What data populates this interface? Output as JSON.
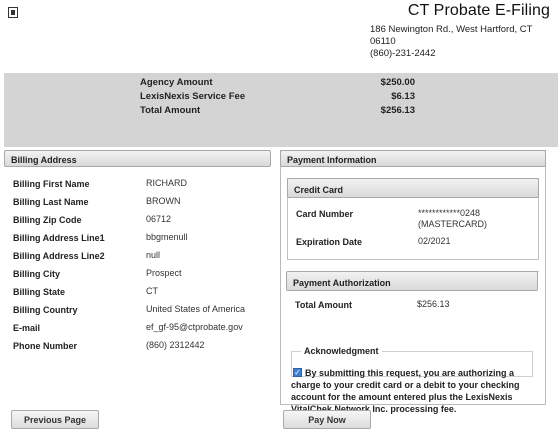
{
  "header": {
    "brand_title": "CT Probate E-Filing",
    "address_line": "186 Newington Rd., West Hartford, CT 06110",
    "phone": "(860)-231-2442"
  },
  "summary": {
    "rows": [
      {
        "label": "Agency Amount",
        "amount": "$250.00"
      },
      {
        "label": "LexisNexis Service Fee",
        "amount": "$6.13"
      },
      {
        "label": "Total Amount",
        "amount": "$256.13"
      }
    ]
  },
  "billing": {
    "title": "Billing Address",
    "rows": [
      {
        "label": "Billing First Name",
        "value": "RICHARD"
      },
      {
        "label": "Billing Last Name",
        "value": "BROWN"
      },
      {
        "label": "Billing Zip Code",
        "value": "06712"
      },
      {
        "label": "Billing Address Line1",
        "value": "bbgmenull"
      },
      {
        "label": "Billing Address Line2",
        "value": "null"
      },
      {
        "label": "Billing City",
        "value": "Prospect"
      },
      {
        "label": "Billing State",
        "value": "CT"
      },
      {
        "label": "Billing Country",
        "value": "United States of America"
      },
      {
        "label": "E-mail",
        "value": "ef_gf-95@ctprobate.gov"
      },
      {
        "label": "Phone Number",
        "value": "(860) 2312442"
      }
    ]
  },
  "payment": {
    "title": "Payment Information",
    "credit_card": {
      "title": "Credit Card",
      "card_number_label": "Card Number",
      "card_number_value": "************0248 (MASTERCARD)",
      "expiration_label": "Expiration Date",
      "expiration_value": "02/2021"
    },
    "authorization": {
      "title": "Payment Authorization",
      "total_label": "Total Amount",
      "total_value": "$256.13",
      "acknowledgment_legend": "Acknowledgment",
      "acknowledgment_checked": true,
      "acknowledgment_text": "By submitting this request, you are authorizing a charge to your credit card or a debit to your checking account for the amount entered plus the LexisNexis VitalChek Network Inc. processing fee."
    }
  },
  "buttons": {
    "previous_page": "Previous Page",
    "pay_now": "Pay Now"
  }
}
